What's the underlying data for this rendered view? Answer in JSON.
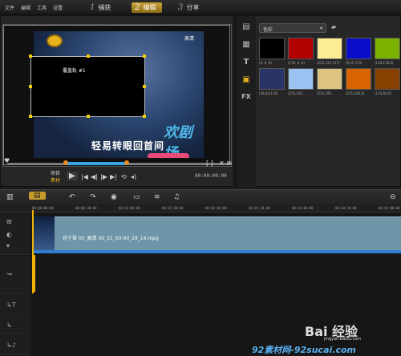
{
  "menu": [
    "文件",
    "编辑",
    "工具",
    "设置"
  ],
  "steps": [
    {
      "num": "1",
      "label": "捕获"
    },
    {
      "num": "2",
      "label": "编辑"
    },
    {
      "num": "3",
      "label": "分享"
    }
  ],
  "preview": {
    "video_top_label": "高清",
    "overlay_title": "覆盖轨 #1",
    "brand_text": "欢剧场",
    "subtitle": "轻易转眼回首间",
    "project_label": "项目",
    "clip_label": "素材",
    "timecode": "00:00:00:00"
  },
  "library": {
    "dropdown_value": "色彩",
    "swatches": [
      {
        "color": "#000000",
        "label": "(0, 0, 0)"
      },
      {
        "color": "#b00000",
        "label": "(176, 0, 0)"
      },
      {
        "color": "#fdee93",
        "label": "(255,237,157)"
      },
      {
        "color": "#0a0ec8",
        "label": "(9,15,172)"
      },
      {
        "color": "#7cb200",
        "label": "(118,178,0)"
      },
      {
        "color": "#2a3466",
        "label": "(38,44,116)"
      },
      {
        "color": "#9bc3f2",
        "label": "(155,192..."
      },
      {
        "color": "#dcc37f",
        "label": "(215,185..."
      },
      {
        "color": "#d76400",
        "label": "(221,100,0)"
      },
      {
        "color": "#864000",
        "label": "(134,64,0)"
      }
    ]
  },
  "timeline": {
    "ruler_ticks": [
      "00:00:00:00",
      "00:00:30:00",
      "00:01:00:00",
      "00:01:30:00",
      "00:02:00:00",
      "00:02:30:00",
      "00:03:00:00",
      "00:03:30:00",
      "00:04:00:00"
    ],
    "clip_name": "花千骨 05_高清 00_21_03-00_29_14.mpg"
  },
  "watermark": {
    "text": "Bai 经验",
    "url": "jingyan.baidu.com",
    "site": "92素材网-92sucai.com"
  }
}
